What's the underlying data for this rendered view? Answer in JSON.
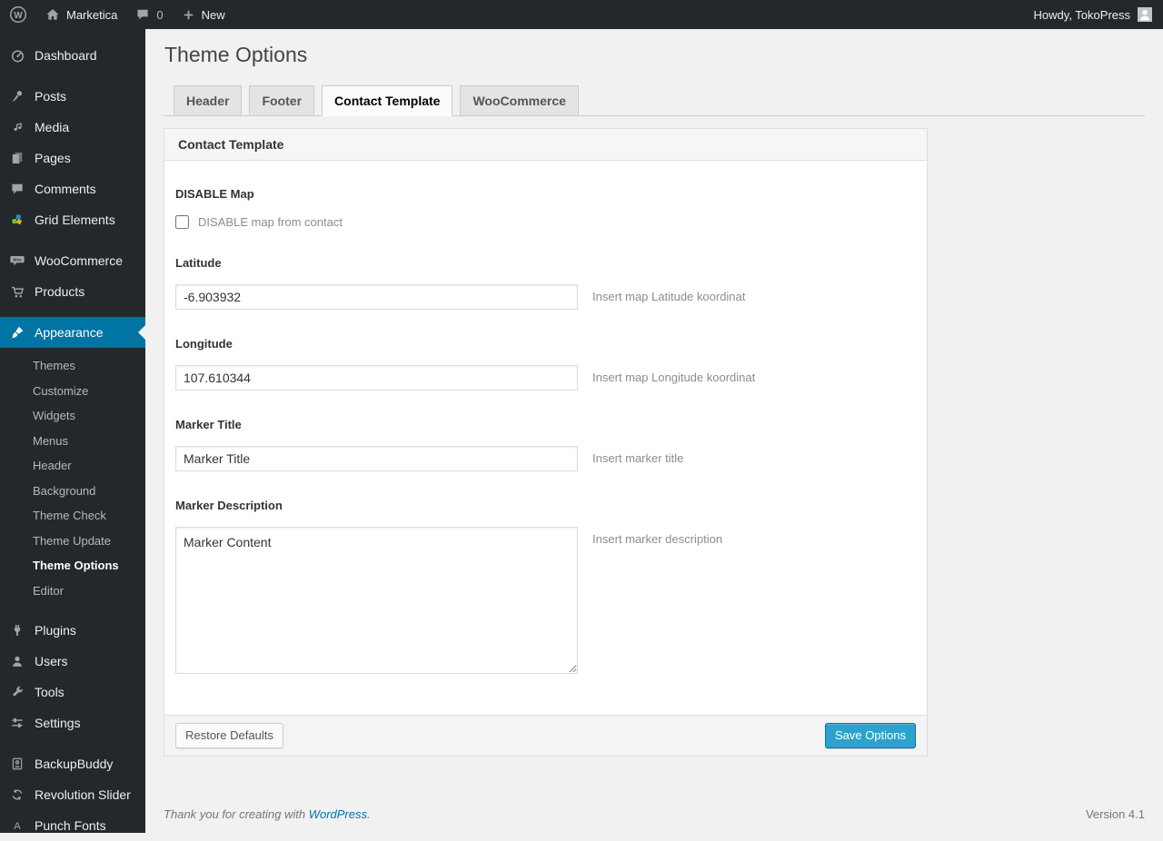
{
  "admin_bar": {
    "site_name": "Marketica",
    "comment_count": "0",
    "new_label": "New",
    "howdy": "Howdy, TokoPress"
  },
  "sidebar": {
    "items": [
      {
        "label": "Dashboard"
      },
      {
        "label": "Posts"
      },
      {
        "label": "Media"
      },
      {
        "label": "Pages"
      },
      {
        "label": "Comments"
      },
      {
        "label": "Grid Elements"
      },
      {
        "label": "WooCommerce"
      },
      {
        "label": "Products"
      },
      {
        "label": "Appearance"
      },
      {
        "label": "Plugins"
      },
      {
        "label": "Users"
      },
      {
        "label": "Tools"
      },
      {
        "label": "Settings"
      },
      {
        "label": "BackupBuddy"
      },
      {
        "label": "Revolution Slider"
      },
      {
        "label": "Punch Fonts"
      }
    ],
    "active_item": "Appearance",
    "appearance_submenu": {
      "items": [
        "Themes",
        "Customize",
        "Widgets",
        "Menus",
        "Header",
        "Background",
        "Theme Check",
        "Theme Update",
        "Theme Options",
        "Editor"
      ],
      "active": "Theme Options"
    }
  },
  "main": {
    "page_title": "Theme Options",
    "tabs": [
      {
        "label": "Header",
        "active": false
      },
      {
        "label": "Footer",
        "active": false
      },
      {
        "label": "Contact Template",
        "active": true
      },
      {
        "label": "WooCommerce",
        "active": false
      }
    ],
    "panel": {
      "title": "Contact Template",
      "fields": {
        "disable_map": {
          "label": "DISABLE Map",
          "checkbox_label": "DISABLE map from contact",
          "checked": false
        },
        "latitude": {
          "label": "Latitude",
          "value": "-6.903932",
          "help": "Insert map Latitude koordinat"
        },
        "longitude": {
          "label": "Longitude",
          "value": "107.610344",
          "help": "Insert map Longitude koordinat"
        },
        "marker_title": {
          "label": "Marker Title",
          "value": "Marker Title",
          "help": "Insert marker title"
        },
        "marker_description": {
          "label": "Marker Description",
          "value": "Marker Content",
          "help": "Insert marker description"
        }
      },
      "buttons": {
        "restore": "Restore Defaults",
        "save": "Save Options"
      }
    },
    "footer": {
      "thanks_prefix": "Thank you for creating with ",
      "wordpress_link": "WordPress",
      "thanks_suffix": ".",
      "version": "Version 4.1"
    }
  },
  "colors": {
    "admin_dark": "#23282d",
    "menu_highlight": "#0074a2",
    "primary_button": "#2ea2cc",
    "page_background": "#f1f1f1",
    "link_blue": "#0074a2"
  }
}
